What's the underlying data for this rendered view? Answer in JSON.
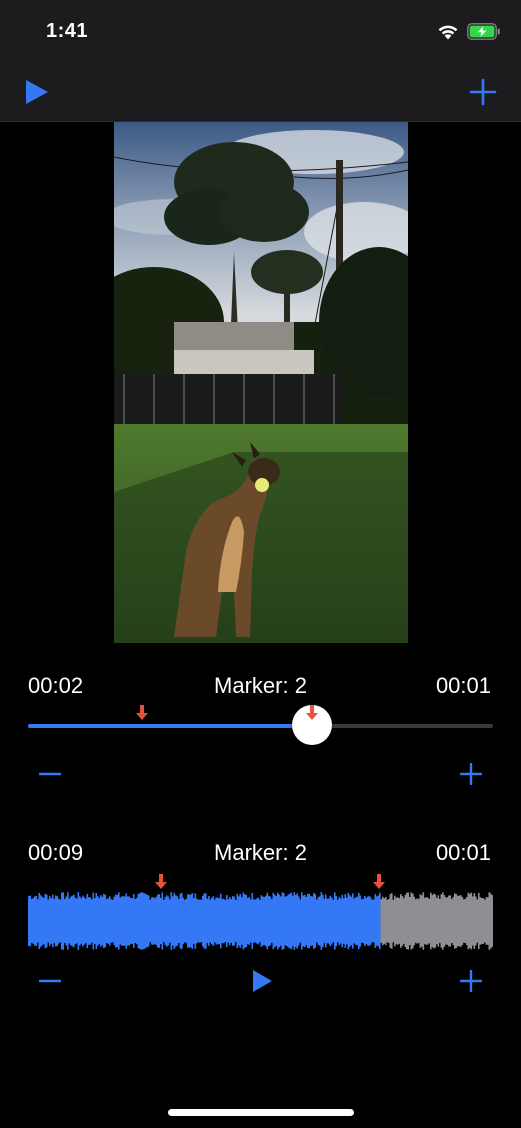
{
  "status_bar": {
    "time": "1:41"
  },
  "video": {
    "icons": [
      "play-icon",
      "add-icon"
    ]
  },
  "trim": {
    "start_time": "00:02",
    "marker_label": "Marker: 2",
    "end_time": "00:01",
    "position_fraction": 0.61,
    "marker_fractions": [
      0.245,
      0.615
    ]
  },
  "audio": {
    "start_time": "00:09",
    "marker_label": "Marker: 2",
    "end_time": "00:01",
    "played_fraction": 0.755,
    "marker_fractions": [
      0.285,
      0.755
    ]
  },
  "colors": {
    "accent": "#3478f6",
    "marker": "#e5533d",
    "wave_unplayed": "#8e8e93",
    "battery": "#32d74b"
  }
}
